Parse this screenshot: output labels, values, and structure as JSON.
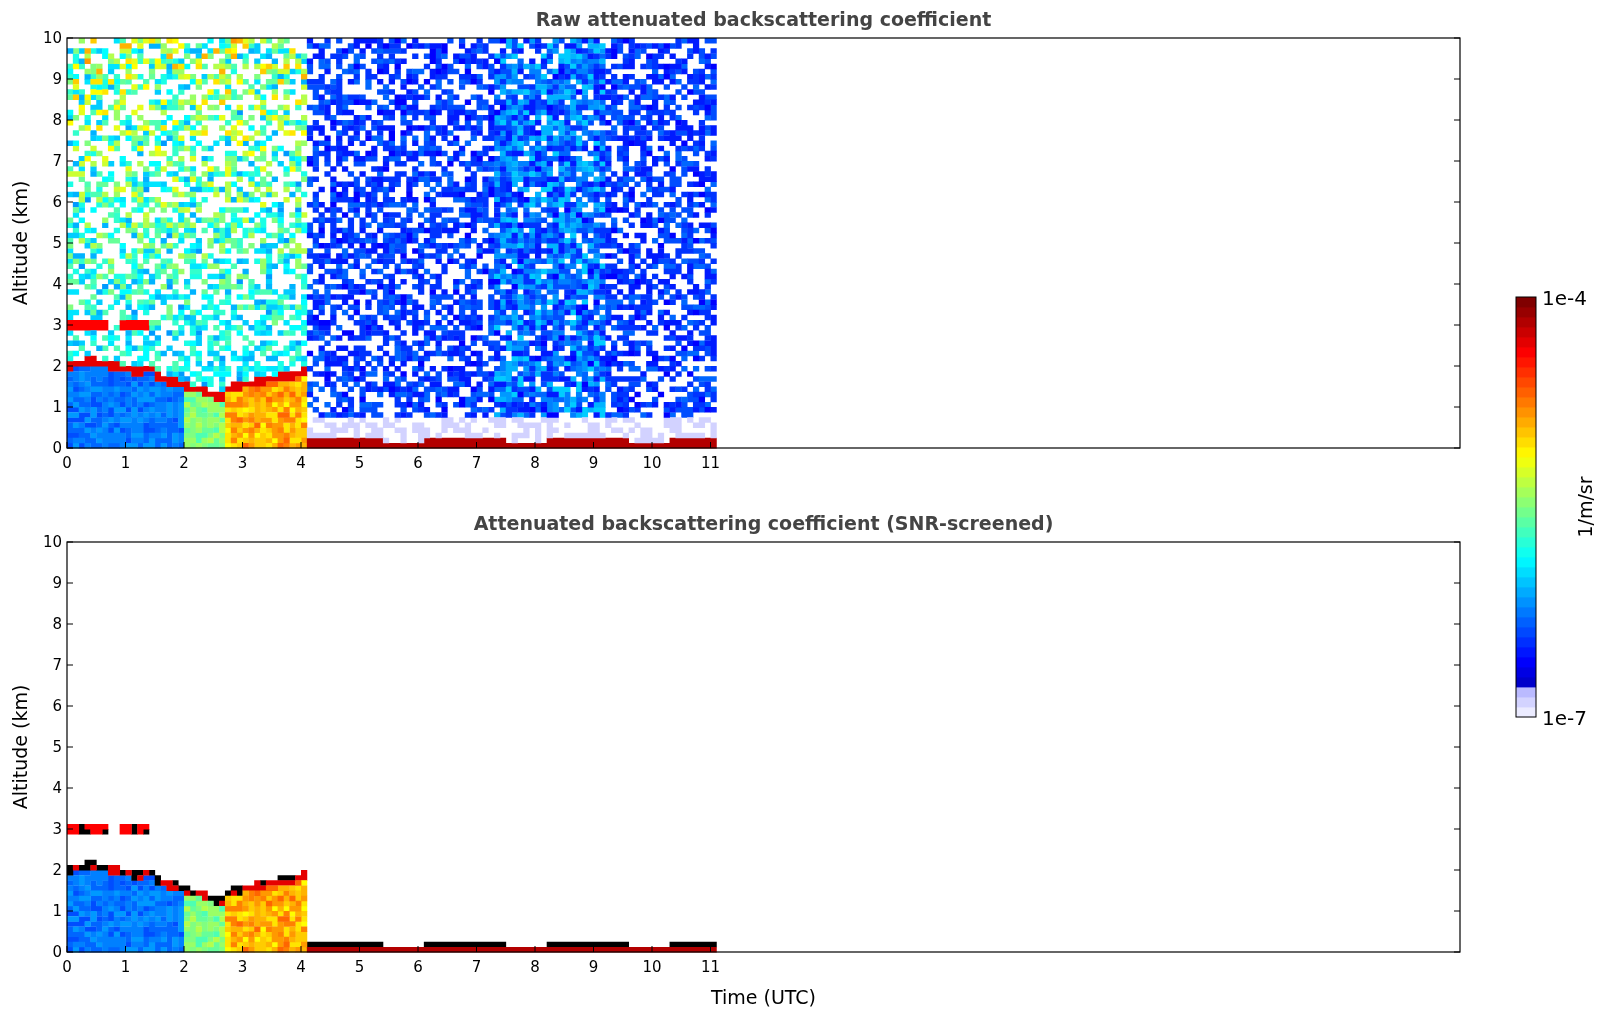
{
  "panels": [
    {
      "kind": "raw",
      "title": "Raw attenuated backscattering coefficient",
      "ylabel": "Altitude (km)",
      "yticks": [
        "10",
        "9",
        "8",
        "7",
        "6",
        "5",
        "4",
        "3",
        "2",
        "1",
        "0"
      ],
      "xticks": [
        "0",
        "1",
        "2",
        "3",
        "4",
        "5",
        "6",
        "7",
        "8",
        "9",
        "10",
        "11"
      ]
    },
    {
      "kind": "screened",
      "title": "Attenuated backscattering coefficient (SNR-screened)",
      "ylabel": "Altitude (km)",
      "yticks": [
        "10",
        "9",
        "8",
        "7",
        "6",
        "5",
        "4",
        "3",
        "2",
        "1",
        "0"
      ],
      "xticks": [
        "0",
        "1",
        "2",
        "3",
        "4",
        "5",
        "6",
        "7",
        "8",
        "9",
        "10",
        "11"
      ],
      "xlabel": "Time (UTC)"
    }
  ],
  "colorbar": {
    "label": "1/m/sr",
    "max": "1e-4",
    "min": "1e-7"
  }
}
